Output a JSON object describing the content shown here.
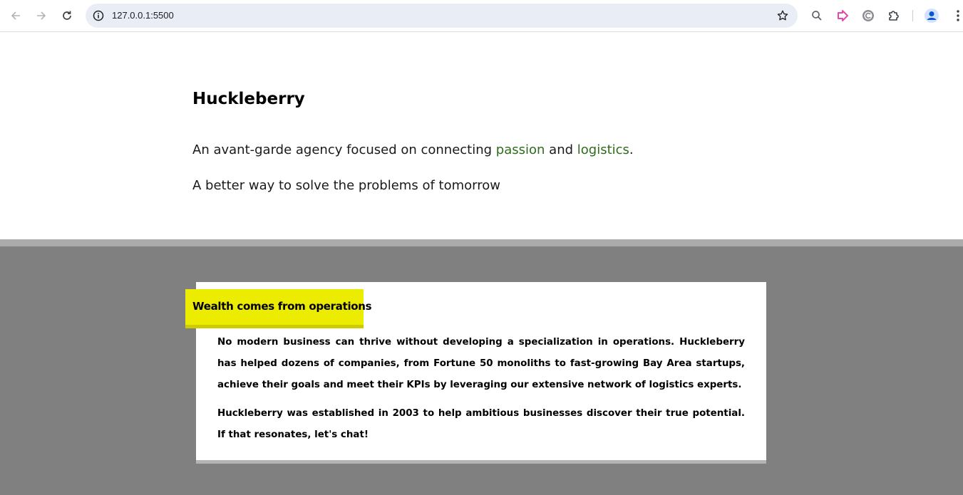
{
  "browser": {
    "url": "127.0.0.1:5500"
  },
  "page": {
    "title": "Huckleberry",
    "tagline": {
      "before": "An avant-garde agency focused on connecting ",
      "link1": "passion",
      "middle": " and ",
      "link2": "logistics",
      "after": "."
    },
    "subline": "A better way to solve the problems of tomorrow",
    "accent_color": "#2e6b1a"
  },
  "card": {
    "heading": "Wealth comes from operations",
    "paragraphs": [
      "No modern business can thrive without developing a specialization in operations. Huckleberry has helped dozens of companies, from Fortune 50 monoliths to fast-growing Bay Area startups, achieve their goals and meet their KPIs by leveraging our extensive network of logistics experts.",
      "Huckleberry was established in 2003 to help ambitious businesses discover their true potential. If that resonates, let's chat!"
    ],
    "tag_color": "#ecec00"
  }
}
